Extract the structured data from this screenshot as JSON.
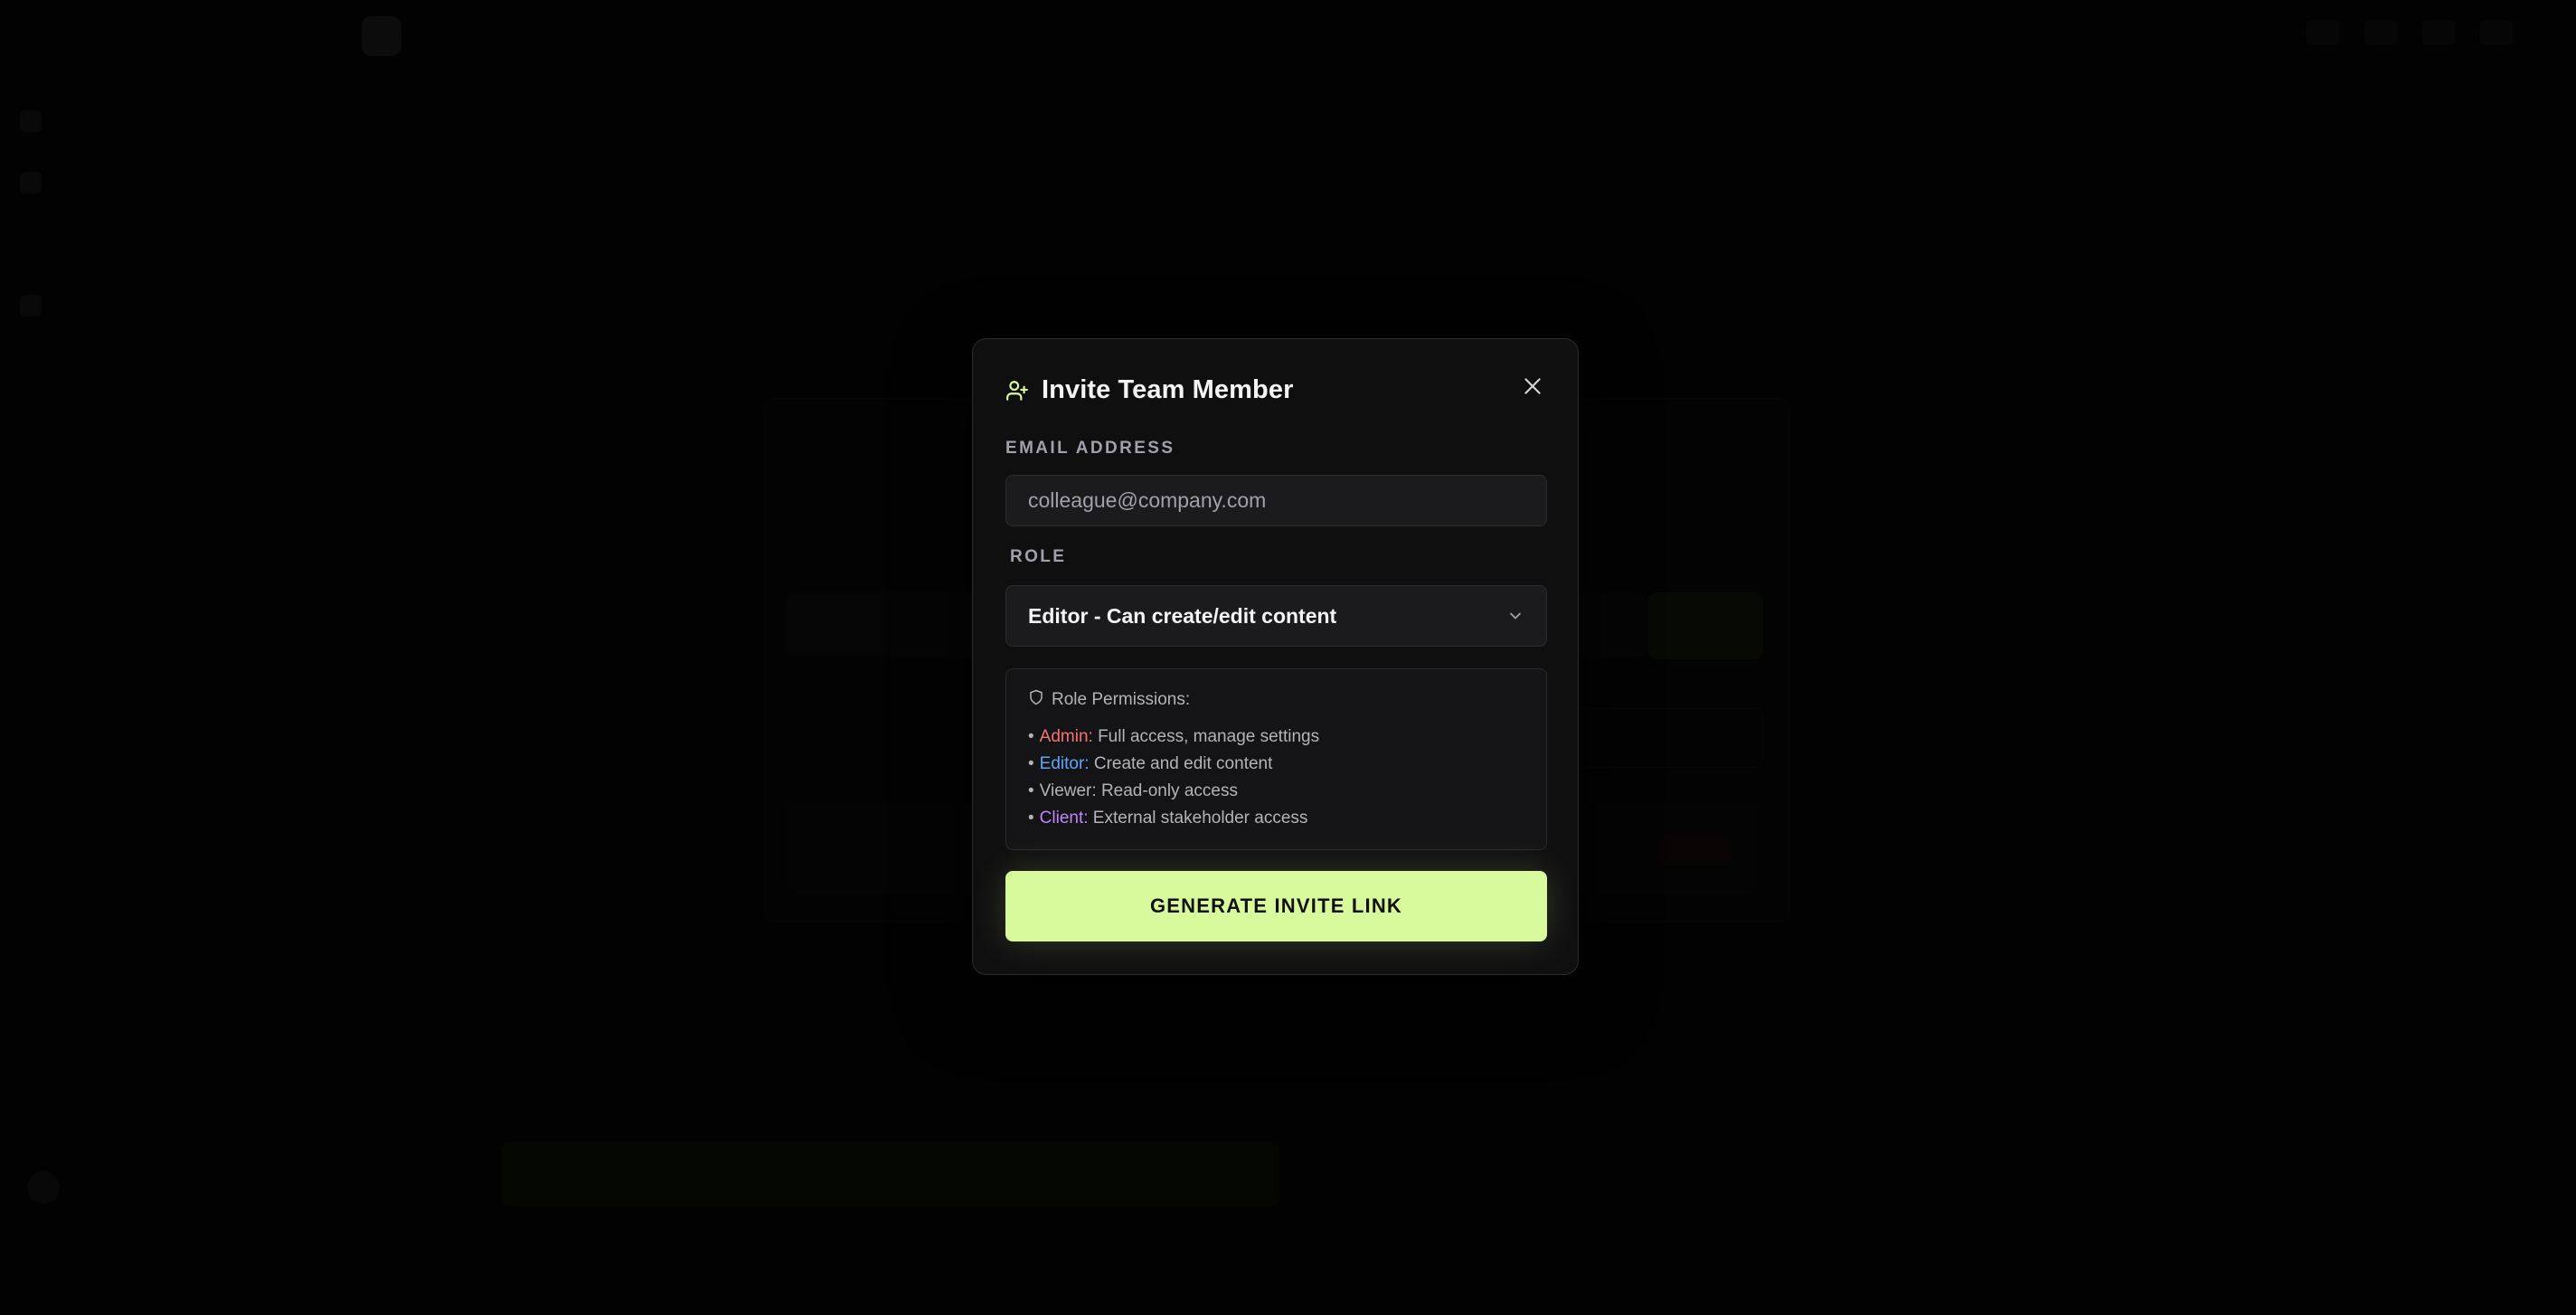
{
  "modal": {
    "title": "Invite Team Member",
    "email": {
      "label": "EMAIL ADDRESS",
      "placeholder": "colleague@company.com",
      "value": ""
    },
    "role": {
      "label": "ROLE",
      "selected": "Editor - Can create/edit content"
    },
    "permissions": {
      "heading": "Role Permissions:",
      "items": [
        {
          "role": "Admin:",
          "desc": "Full access, manage settings",
          "color": "#f87171"
        },
        {
          "role": "Editor:",
          "desc": "Create and edit content",
          "color": "#60a5fa"
        },
        {
          "role": "Viewer:",
          "desc": "Read-only access",
          "color": "#b4b4b8"
        },
        {
          "role": "Client:",
          "desc": "External stakeholder access",
          "color": "#c084fc"
        }
      ]
    },
    "submit_label": "GENERATE INVITE LINK"
  },
  "colors": {
    "accent_lime": "#d9f99d",
    "icon_lime": "#d9f99d",
    "overlay": "#000000"
  },
  "icons": {
    "title_icon": "user-plus-icon",
    "close_icon": "close-icon",
    "select_icon": "chevron-down-icon",
    "permission_icon": "shield-icon"
  }
}
